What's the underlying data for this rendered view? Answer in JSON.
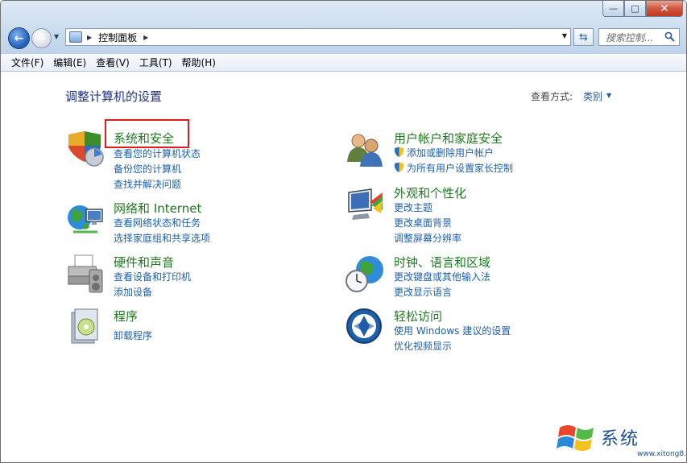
{
  "address": {
    "path_label": "控制面板"
  },
  "search": {
    "placeholder": "搜索控制..."
  },
  "menu": {
    "items": [
      "文件(F)",
      "编辑(E)",
      "查看(V)",
      "工具(T)",
      "帮助(H)"
    ]
  },
  "main": {
    "title": "调整计算机的设置",
    "view_label": "查看方式:",
    "view_value": "类别"
  },
  "categories": [
    {
      "title": "系统和安全",
      "icon": "shield-icon",
      "links": [
        "查看您的计算机状态",
        "备份您的计算机",
        "查找并解决问题"
      ]
    },
    {
      "title": "网络和 Internet",
      "icon": "network-icon",
      "links": [
        "查看网络状态和任务",
        "选择家庭组和共享选项"
      ]
    },
    {
      "title": "硬件和声音",
      "icon": "printer-icon",
      "links": [
        "查看设备和打印机",
        "添加设备"
      ]
    },
    {
      "title": "程序",
      "icon": "programs-icon",
      "links": [
        "卸载程序"
      ]
    },
    {
      "title": "用户帐户和家庭安全",
      "icon": "users-icon",
      "links": [
        "添加或删除用户帐户",
        "为所有用户设置家长控制"
      ]
    },
    {
      "title": "外观和个性化",
      "icon": "display-icon",
      "links": [
        "更改主题",
        "更改桌面背景",
        "调整屏幕分辨率"
      ]
    },
    {
      "title": "时钟、语言和区域",
      "icon": "clock-globe-icon",
      "links": [
        "更改键盘或其他输入法",
        "更改显示语言"
      ]
    },
    {
      "title": "轻松访问",
      "icon": "ease-of-access-icon",
      "links": [
        "使用 Windows 建议的设置",
        "优化视频显示"
      ]
    }
  ],
  "watermark": {
    "text": "系统",
    "url": "www.xitong8.com"
  },
  "colors": {
    "category_title": "#1f7a1f",
    "link": "#1c5fb3",
    "page_title": "#1e3287",
    "highlight": "#e21a1a"
  }
}
